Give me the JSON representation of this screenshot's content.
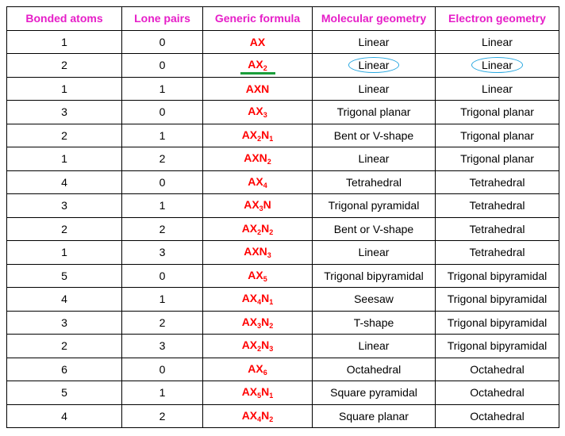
{
  "colors": {
    "header": "#e61ec8",
    "formula": "#ff0000",
    "circle": "#29a8e0",
    "underline": "#1a9e3a"
  },
  "headers": [
    "Bonded atoms",
    "Lone pairs",
    "Generic formula",
    "Molecular geometry",
    "Electron geometry"
  ],
  "rows": [
    {
      "bonded": "1",
      "lone": "0",
      "formula": [
        "AX"
      ],
      "molecular": "Linear",
      "electron": "Linear"
    },
    {
      "bonded": "2",
      "lone": "0",
      "formula": [
        "AX",
        "2"
      ],
      "molecular": "Linear",
      "electron": "Linear",
      "highlighted": true
    },
    {
      "bonded": "1",
      "lone": "1",
      "formula": [
        "AXN"
      ],
      "molecular": "Linear",
      "electron": "Linear"
    },
    {
      "bonded": "3",
      "lone": "0",
      "formula": [
        "AX",
        "3"
      ],
      "molecular": "Trigonal planar",
      "electron": "Trigonal planar"
    },
    {
      "bonded": "2",
      "lone": "1",
      "formula": [
        "AX",
        "2",
        "N",
        "1"
      ],
      "molecular": "Bent or V-shape",
      "electron": "Trigonal planar"
    },
    {
      "bonded": "1",
      "lone": "2",
      "formula": [
        "AXN",
        "2"
      ],
      "molecular": "Linear",
      "electron": "Trigonal planar"
    },
    {
      "bonded": "4",
      "lone": "0",
      "formula": [
        "AX",
        "4"
      ],
      "molecular": "Tetrahedral",
      "electron": "Tetrahedral"
    },
    {
      "bonded": "3",
      "lone": "1",
      "formula": [
        "AX",
        "3",
        "N"
      ],
      "molecular": "Trigonal pyramidal",
      "electron": "Tetrahedral"
    },
    {
      "bonded": "2",
      "lone": "2",
      "formula": [
        "AX",
        "2",
        "N",
        "2"
      ],
      "molecular": "Bent or V-shape",
      "electron": "Tetrahedral"
    },
    {
      "bonded": "1",
      "lone": "3",
      "formula": [
        "AXN",
        "3"
      ],
      "molecular": "Linear",
      "electron": "Tetrahedral"
    },
    {
      "bonded": "5",
      "lone": "0",
      "formula": [
        "AX",
        "5"
      ],
      "molecular": "Trigonal bipyramidal",
      "electron": "Trigonal bipyramidal"
    },
    {
      "bonded": "4",
      "lone": "1",
      "formula": [
        "AX",
        "4",
        "N",
        "1"
      ],
      "molecular": "Seesaw",
      "electron": "Trigonal bipyramidal"
    },
    {
      "bonded": "3",
      "lone": "2",
      "formula": [
        "AX",
        "3",
        "N",
        "2"
      ],
      "molecular": "T-shape",
      "electron": "Trigonal bipyramidal"
    },
    {
      "bonded": "2",
      "lone": "3",
      "formula": [
        "AX",
        "2",
        "N",
        "3"
      ],
      "molecular": "Linear",
      "electron": "Trigonal bipyramidal"
    },
    {
      "bonded": "6",
      "lone": "0",
      "formula": [
        "AX",
        "6"
      ],
      "molecular": "Octahedral",
      "electron": "Octahedral"
    },
    {
      "bonded": "5",
      "lone": "1",
      "formula": [
        "AX",
        "5",
        "N",
        "1"
      ],
      "molecular": "Square pyramidal",
      "electron": "Octahedral"
    },
    {
      "bonded": "4",
      "lone": "2",
      "formula": [
        "AX",
        "4",
        "N",
        "2"
      ],
      "molecular": "Square planar",
      "electron": "Octahedral"
    }
  ]
}
